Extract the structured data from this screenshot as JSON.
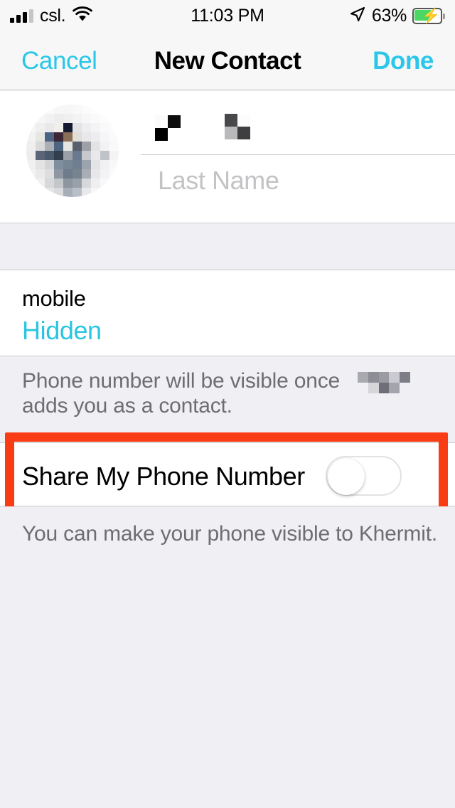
{
  "status_bar": {
    "carrier": "csl.",
    "time": "11:03 PM",
    "battery_percent": "63%",
    "signal_bars_filled": 3,
    "signal_bars_total": 4,
    "wifi_icon": "wifi-icon",
    "location_icon": "location-arrow-icon",
    "battery_icon": "battery-charging-icon",
    "battery_charging": true,
    "battery_fill_color": "#4CD764"
  },
  "nav_bar": {
    "cancel_label": "Cancel",
    "title": "New Contact",
    "done_label": "Done",
    "tint_color": "#2BC7E8"
  },
  "contact_header": {
    "avatar_name": "contact-photo",
    "avatar_redacted": true,
    "first_name_value": "",
    "first_name_redacted": true,
    "last_name_placeholder": "Last Name",
    "last_name_value": ""
  },
  "phone_section": {
    "label": "mobile",
    "value": "Hidden",
    "value_color": "#2BC5E0",
    "footer_line1": "Phone number will be visible once",
    "footer_line2": "adds you as a contact.",
    "footer_redacted_name": true
  },
  "share_section": {
    "label": "Share My Phone Number",
    "toggle_name": "share-phone-number-toggle",
    "toggle_on": false,
    "footer": "You can make your phone visible to Khermit."
  },
  "annotation": {
    "highlight_color": "#F93C13",
    "target": "share-phone-number-row"
  }
}
